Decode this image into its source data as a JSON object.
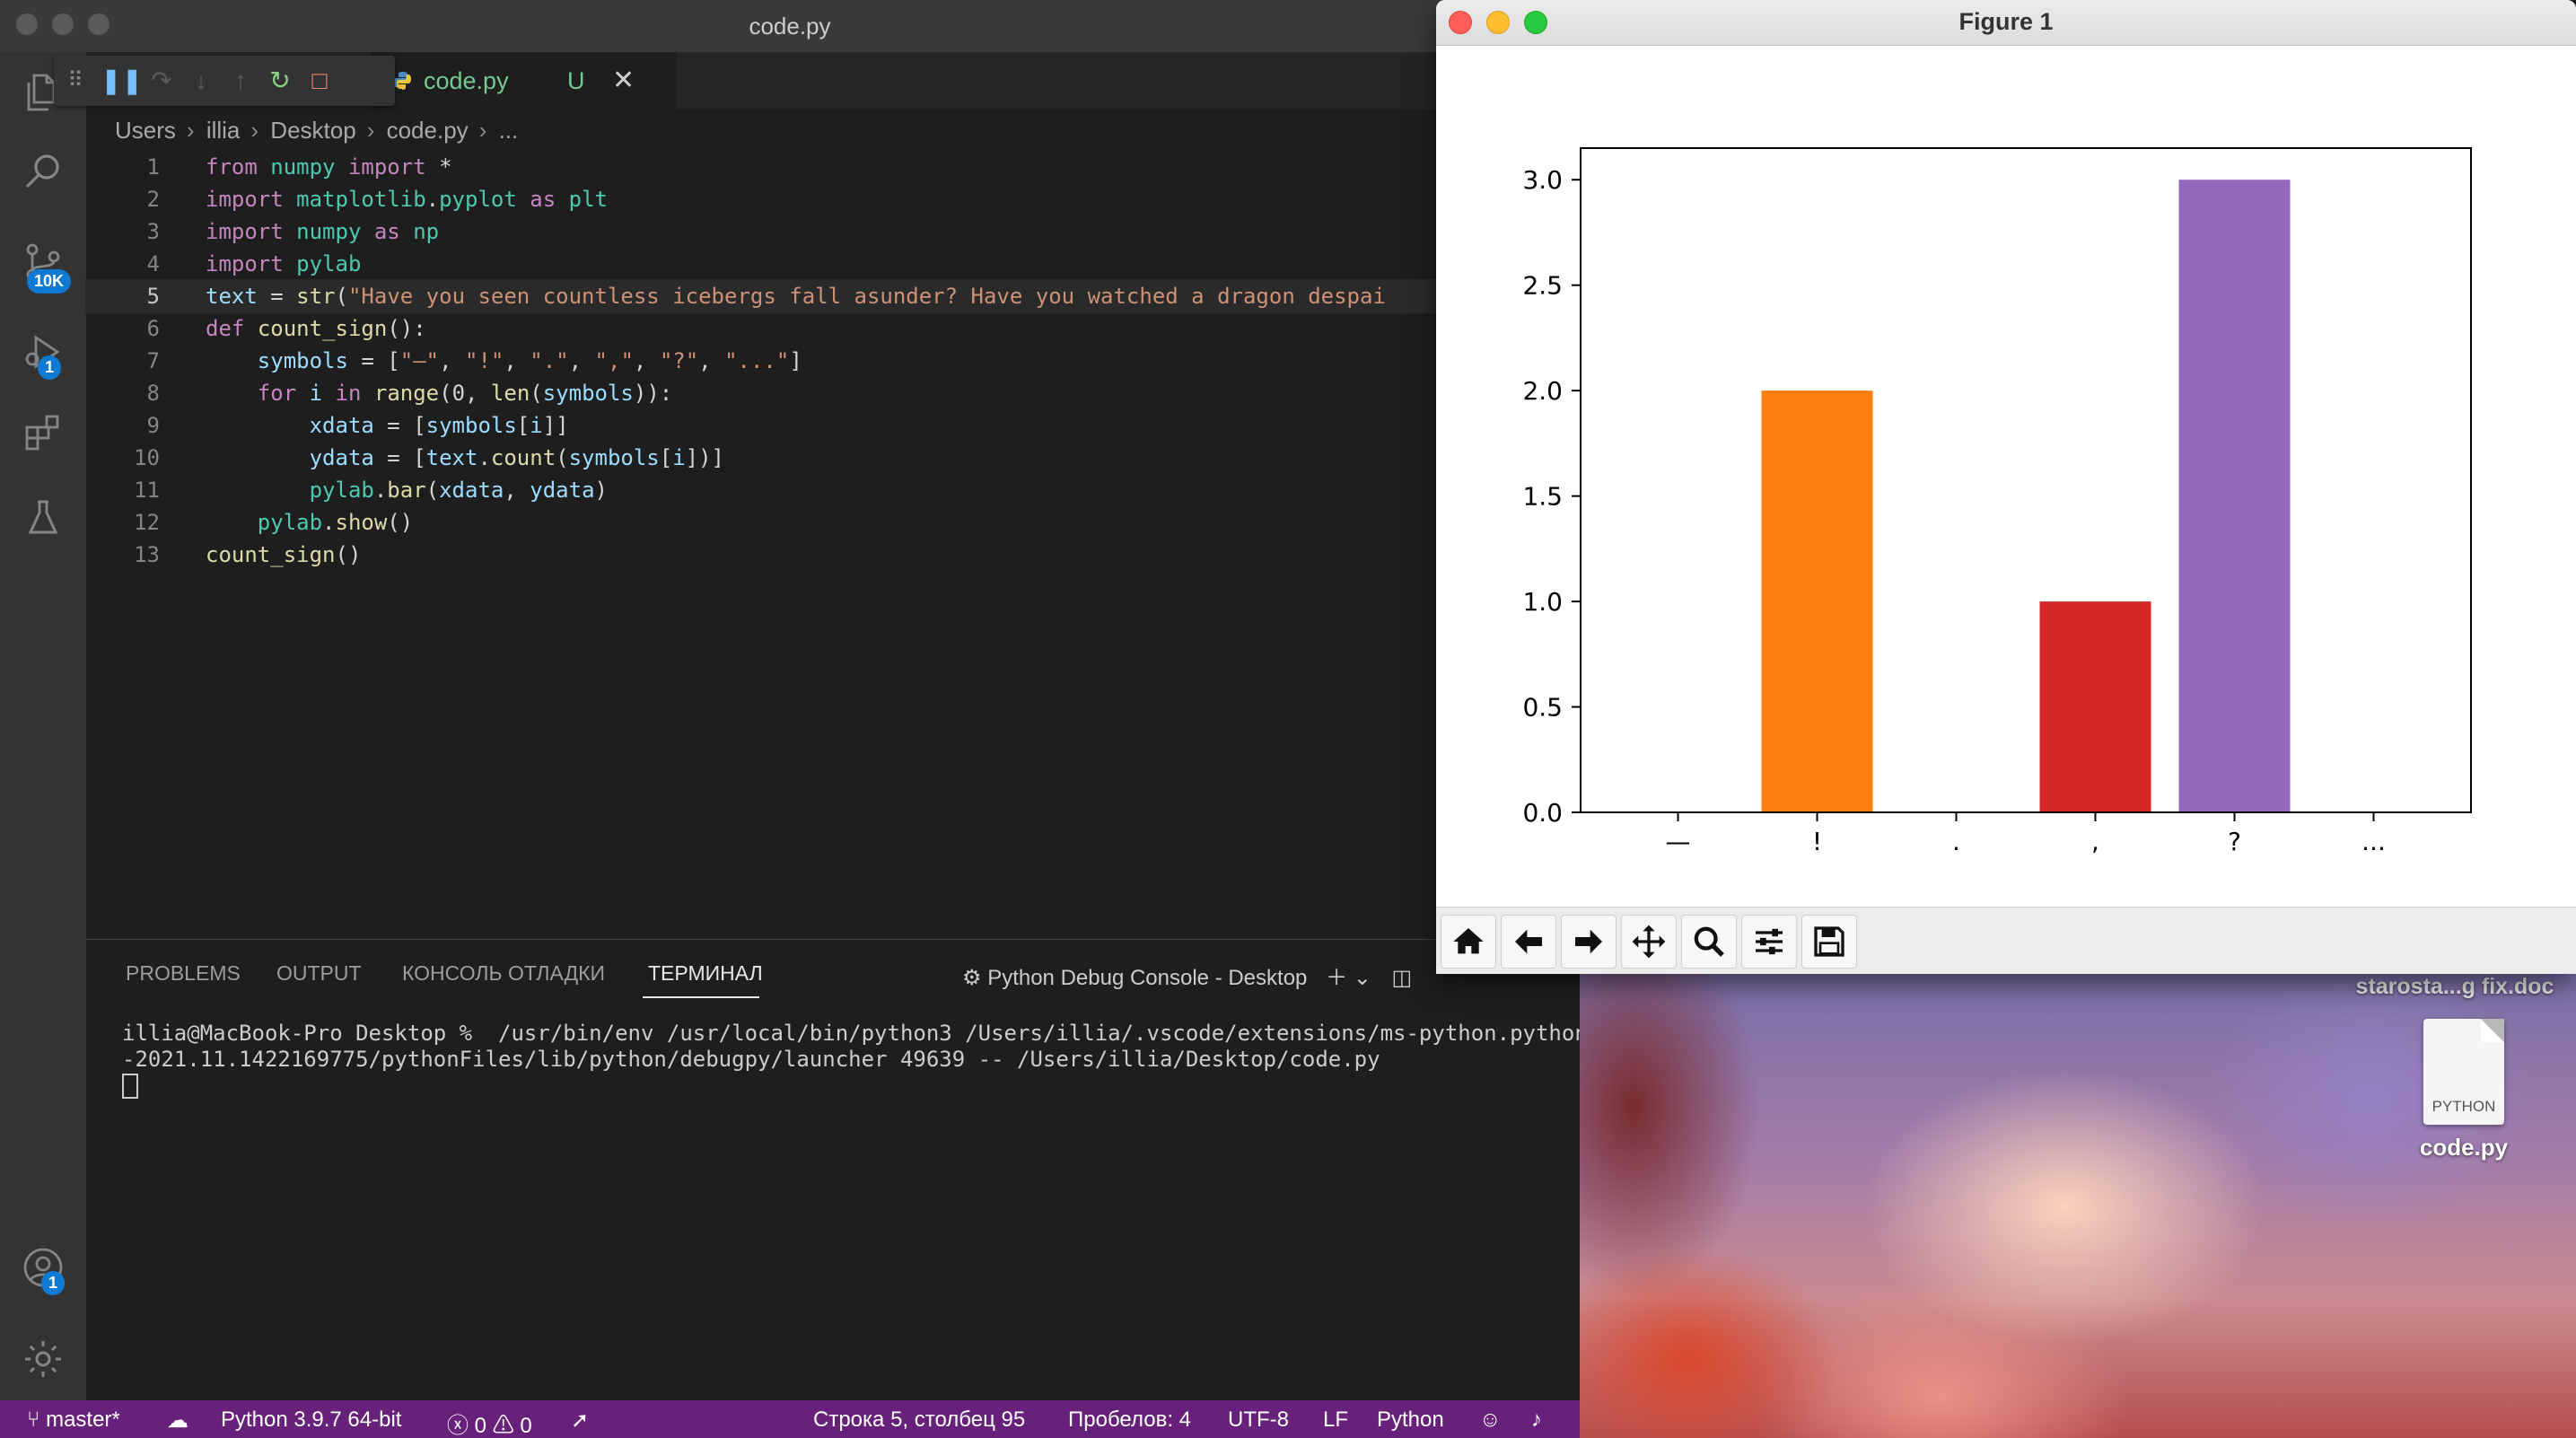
{
  "vscode": {
    "window_title": "code.py",
    "tab": {
      "filename": "code.py",
      "modified_flag": "U"
    },
    "breadcrumb": [
      "Users",
      "illia",
      "Desktop",
      "code.py",
      "..."
    ],
    "badges": {
      "source_control": "10K",
      "run_debug": "1",
      "accounts": "1"
    },
    "code_lines": [
      "from numpy import *",
      "import matplotlib.pyplot as plt",
      "import numpy as np",
      "import pylab",
      "text = str(\"Have you seen countless icebergs fall asunder? Have you watched a dragon despai",
      "def count_sign():",
      "    symbols = [\"—\", \"!\", \".\", \",\", \"?\", \"...\"]",
      "    for i in range(0, len(symbols)):",
      "        xdata = [symbols[i]]",
      "        ydata = [text.count(symbols[i])]",
      "        pylab.bar(xdata, ydata)",
      "    pylab.show()",
      "count_sign()"
    ],
    "active_line": 5,
    "panel": {
      "tabs": [
        "PROBLEMS",
        "OUTPUT",
        "КОНСОЛЬ ОТЛАДКИ",
        "ТЕРМИНАЛ"
      ],
      "active_tab": "ТЕРМИНАЛ",
      "console_selector": "Python Debug Console - Desktop",
      "terminal_lines": [
        "illia@MacBook-Pro Desktop %  /usr/bin/env /usr/local/bin/python3 /Users/illia/.vscode/extensions/ms-python.python",
        "-2021.11.1422169775/pythonFiles/lib/python/debugpy/launcher 49639 -- /Users/illia/Desktop/code.py"
      ]
    },
    "statusbar": {
      "branch": "master*",
      "interpreter": "Python 3.9.7 64-bit",
      "errors": "0",
      "warnings": "0",
      "cursor_position": "Строка 5, столбец 95",
      "spaces": "Пробелов: 4",
      "encoding": "UTF-8",
      "eol": "LF",
      "language": "Python"
    }
  },
  "figure": {
    "window_title": "Figure 1"
  },
  "desktop": {
    "top_file_label": "starosta...g fix.doc",
    "file_icon_type": "PYTHON",
    "file_name": "code.py"
  },
  "chart_data": {
    "type": "bar",
    "categories": [
      "—",
      "!",
      ".",
      ",",
      "?",
      "..."
    ],
    "values": [
      0,
      2,
      0,
      1,
      3,
      0
    ],
    "colors": [
      "#1f77b4",
      "#ff7f0e",
      "#2ca02c",
      "#d62728",
      "#9467bd",
      "#8c564b"
    ],
    "ylim": [
      0,
      3.15
    ],
    "yticks": [
      "0.0",
      "0.5",
      "1.0",
      "1.5",
      "2.0",
      "2.5",
      "3.0"
    ],
    "ytick_values": [
      0,
      0.5,
      1,
      1.5,
      2,
      2.5,
      3
    ],
    "grid": false
  },
  "colors": {
    "statusbar": "#68217a",
    "accent_badge": "#0e7ad3"
  }
}
